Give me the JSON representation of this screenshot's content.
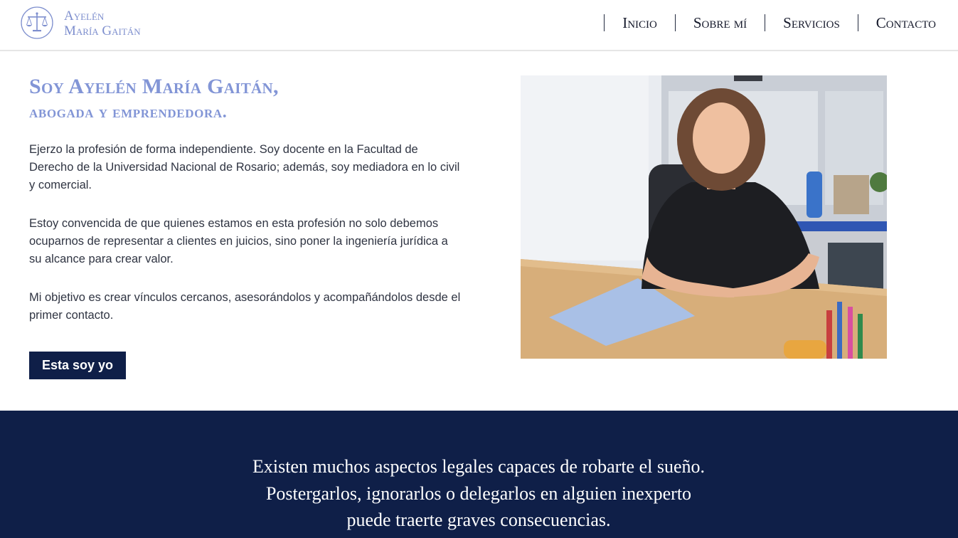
{
  "header": {
    "logo": {
      "line1": "Ayelén",
      "line2": "María Gaitán"
    },
    "nav": [
      {
        "label": "Inicio"
      },
      {
        "label": "Sobre mí"
      },
      {
        "label": "Servicios"
      },
      {
        "label": "Contacto"
      }
    ]
  },
  "intro": {
    "title": "Soy Ayelén María Gaitán,",
    "subtitle": "abogada y emprendedora.",
    "paragraphs": [
      "Ejerzo la profesión de forma independiente. Soy docente en la Facultad de Derecho de la Universidad Nacional de Rosario; además, soy mediadora en lo civil y comercial.",
      "Estoy convencida de que quienes estamos en esta profesión no solo debemos ocuparnos de representar a clientes en juicios, sino poner la ingeniería jurídica a su alcance para crear valor.",
      "Mi objetivo es crear vínculos cercanos, asesorándolos y acompañándolos desde el primer contacto."
    ],
    "cta_label": "Esta soy yo"
  },
  "banner": {
    "lines": [
      "Existen muchos aspectos legales capaces de robarte el sueño.",
      "Postergarlos, ignorarlos o delegarlos en alguien inexperto",
      "puede traerte graves consecuencias."
    ]
  },
  "colors": {
    "accent": "#8295d6",
    "navy": "#0f1f48",
    "text": "#2f3442"
  }
}
